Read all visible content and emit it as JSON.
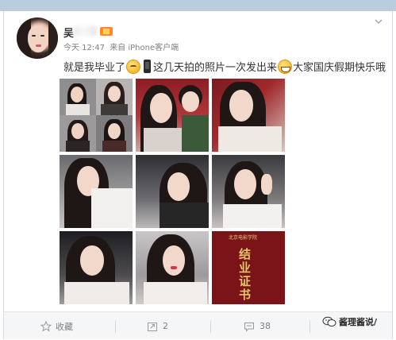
{
  "post": {
    "username": "吴",
    "time": "今天 12:47",
    "source": "来自 iPhone客户端",
    "text_parts": [
      "就是我毕业了",
      "这几天拍的照片一次发出来",
      "大家国庆假期快乐哦"
    ],
    "emojis": [
      "blush-face",
      "phone",
      "grin-face"
    ]
  },
  "photos": [
    {
      "type": "collage",
      "alt": "4-photo collage"
    },
    {
      "type": "selfie",
      "alt": "selfie with friend"
    },
    {
      "type": "selfie",
      "alt": "selfie in car"
    },
    {
      "type": "selfie",
      "alt": "selfie"
    },
    {
      "type": "selfie",
      "alt": "selfie in car seat"
    },
    {
      "type": "selfie",
      "alt": "peace sign selfie"
    },
    {
      "type": "selfie",
      "alt": "selfie long hair"
    },
    {
      "type": "selfie",
      "alt": "selfie"
    },
    {
      "type": "certificate",
      "alt": "graduation certificate"
    }
  ],
  "certificate": {
    "header": "北京电影学院",
    "chars": [
      "结",
      "业",
      "证",
      "书"
    ]
  },
  "actions": {
    "favorite": {
      "label": "收藏",
      "icon": "star-icon"
    },
    "repost": {
      "count": "2",
      "icon": "repost-icon"
    },
    "comment": {
      "count": "38",
      "icon": "comment-icon"
    }
  },
  "watermark": {
    "text": "酱理酱说/"
  },
  "colors": {
    "topbar": "#b9cddd",
    "accent": "#ff8a2b",
    "certificate": "#7a1418"
  }
}
